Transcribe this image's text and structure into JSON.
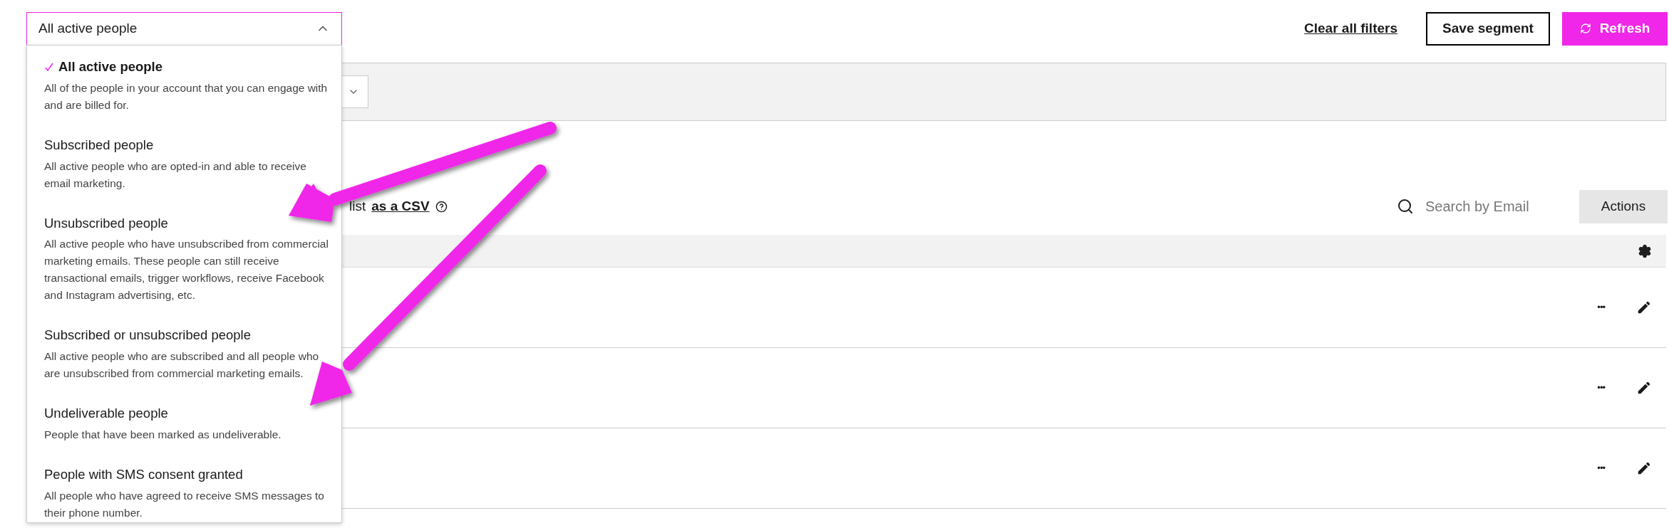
{
  "filter": {
    "value": "All active people",
    "expanded": true,
    "options": [
      {
        "title": "All active people",
        "description": "All of the people in your account that you can engage with and are billed for.",
        "selected": true
      },
      {
        "title": "Subscribed people",
        "description": "All active people who are opted-in and able to receive email marketing.",
        "selected": false
      },
      {
        "title": "Unsubscribed people",
        "description": "All active people who have unsubscribed from commercial marketing emails. These people can still receive transactional emails, trigger workflows, receive Facebook and Instagram advertising, etc.",
        "selected": false
      },
      {
        "title": "Subscribed or unsubscribed people",
        "description": "All active people who are subscribed and all people who are unsubscribed from commercial marketing emails.",
        "selected": false
      },
      {
        "title": "Undeliverable people",
        "description": "People that have been marked as undeliverable.",
        "selected": false
      },
      {
        "title": "People with SMS consent granted",
        "description": "All people who have agreed to receive SMS messages to their phone number.",
        "selected": false
      }
    ]
  },
  "header_actions": {
    "clear_link": "Clear all filters",
    "save_button": "Save segment",
    "refresh_button": "Refresh"
  },
  "export": {
    "text": "list",
    "link": "as a CSV"
  },
  "search": {
    "placeholder": "Search by Email"
  },
  "actions_button": "Actions",
  "rows": [
    {
      "more": "•••"
    },
    {
      "more": "•••"
    },
    {
      "more": "•••"
    }
  ]
}
